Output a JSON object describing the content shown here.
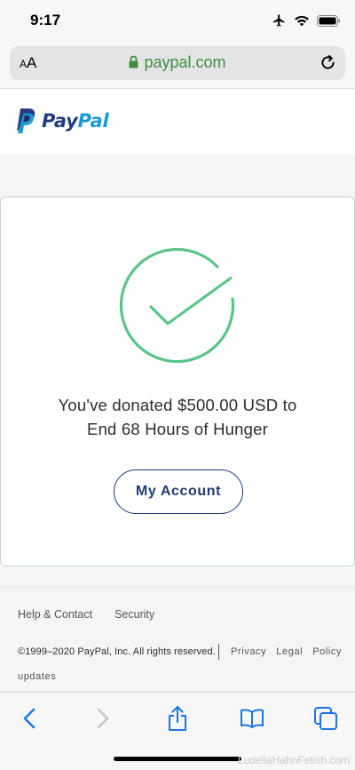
{
  "status_bar": {
    "time": "9:17",
    "icons": [
      "airplane-icon",
      "wifi-icon",
      "battery-icon"
    ]
  },
  "browser": {
    "text_size_label_small": "A",
    "text_size_label_large": "A",
    "url": "paypal.com",
    "url_color": "#3e8e3e"
  },
  "header": {
    "logo_pay": "Pay",
    "logo_pal": "Pal",
    "brand_dark": "#253b80",
    "brand_light": "#179bd7"
  },
  "confirmation": {
    "message_line1": "You've donated $500.00 USD to",
    "message_line2": "End 68 Hours of Hunger",
    "button_label": "My Account",
    "check_color": "#5cc48a"
  },
  "footer": {
    "links": [
      "Help & Contact",
      "Security"
    ],
    "copyright": "©1999–2020  PayPal, Inc. All rights reserved.",
    "legal_links": [
      "Privacy",
      "Legal",
      "Policy"
    ],
    "legal_updates": "updates"
  },
  "toolbar": {
    "icons": [
      "back-icon",
      "forward-icon",
      "share-icon",
      "bookmarks-icon",
      "tabs-icon"
    ]
  },
  "watermark": "LudellaHahnFetish.com"
}
